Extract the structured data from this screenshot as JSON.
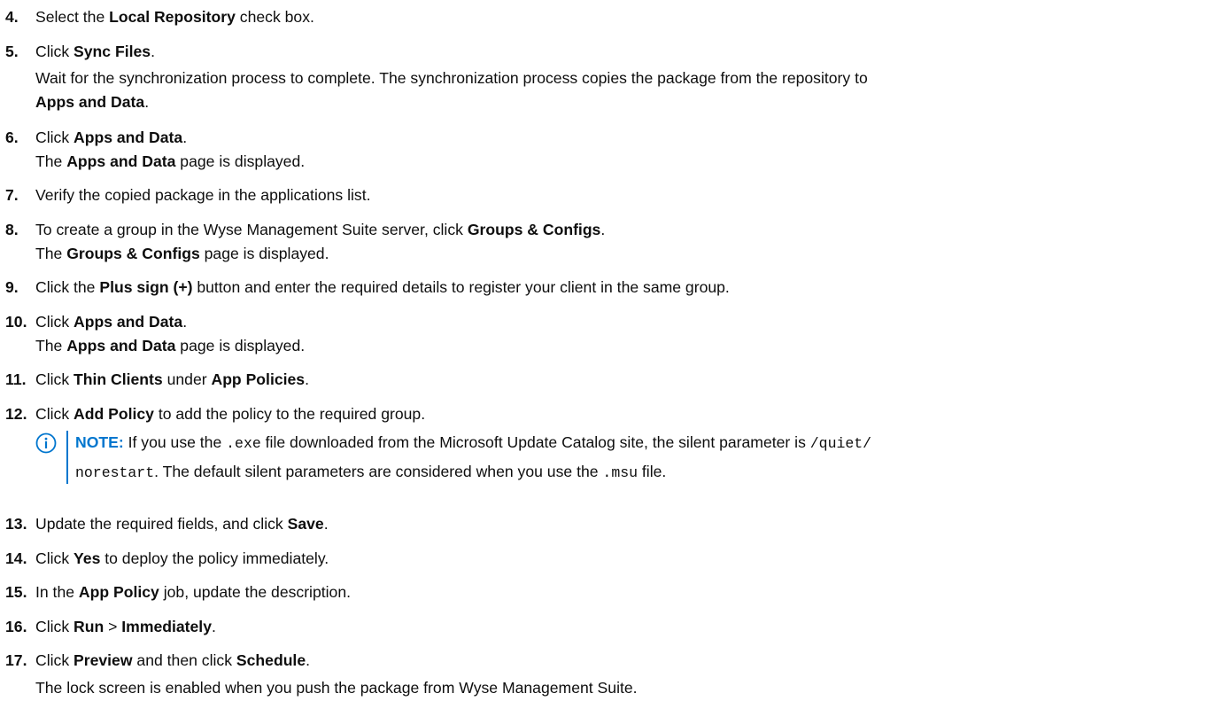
{
  "steps": [
    {
      "num": "4.",
      "pre": "Select the ",
      "b1": "Local Repository",
      "post": " check box."
    },
    {
      "num": "5.",
      "pre": "Click ",
      "b1": "Sync Files",
      "post": ".",
      "body1": "Wait for the synchronization process to complete. The synchronization process copies the package from the repository to",
      "body2_b": "Apps and Data",
      "body2_post": "."
    },
    {
      "num": "6.",
      "pre": "Click ",
      "b1": "Apps and Data",
      "post": ".",
      "body_pre": "The ",
      "body_b": "Apps and Data",
      "body_post": " page is displayed."
    },
    {
      "num": "7.",
      "text": "Verify the copied package in the applications list."
    },
    {
      "num": "8.",
      "pre": "To create a group in the Wyse Management Suite server, click ",
      "b1": "Groups & Configs",
      "post": ".",
      "body_pre": "The ",
      "body_b": "Groups & Configs",
      "body_post": " page is displayed."
    },
    {
      "num": "9.",
      "pre": "Click the ",
      "b1": "Plus sign (+)",
      "post": " button and enter the required details to register your client in the same group."
    },
    {
      "num": "10.",
      "pre": "Click ",
      "b1": "Apps and Data",
      "post": ".",
      "body_pre": "The ",
      "body_b": "Apps and Data",
      "body_post": " page is displayed."
    },
    {
      "num": "11.",
      "pre": "Click ",
      "b1": "Thin Clients",
      "mid": " under ",
      "b2": "App Policies",
      "post": "."
    },
    {
      "num": "12.",
      "pre": "Click ",
      "b1": "Add Policy",
      "post": " to add the policy to the required group."
    },
    {
      "num": "13.",
      "pre": "Update the required fields, and click ",
      "b1": "Save",
      "post": "."
    },
    {
      "num": "14.",
      "pre": "Click ",
      "b1": "Yes",
      "post": " to deploy the policy immediately."
    },
    {
      "num": "15.",
      "pre": "In the ",
      "b1": "App Policy",
      "post": " job, update the description."
    },
    {
      "num": "16.",
      "pre": "Click ",
      "b1": "Run",
      "mid": " > ",
      "b2": "Immediately",
      "post": "."
    },
    {
      "num": "17.",
      "pre": "Click ",
      "b1": "Preview",
      "mid": " and then click ",
      "b2": "Schedule",
      "post": ".",
      "body": "The lock screen is enabled when you push the package from Wyse Management Suite."
    }
  ],
  "note": {
    "label": "NOTE:",
    "l1_a": " If you use the ",
    "l1_code1": ".exe",
    "l1_b": " file downloaded from the Microsoft Update Catalog site, the silent parameter is ",
    "l1_code2": "/quiet/",
    "l2_code": "norestart",
    "l2_a": ". The default silent parameters are considered when you use the ",
    "l2_code2": ".msu",
    "l2_b": " file.",
    "icon_color": "#0076ce"
  }
}
